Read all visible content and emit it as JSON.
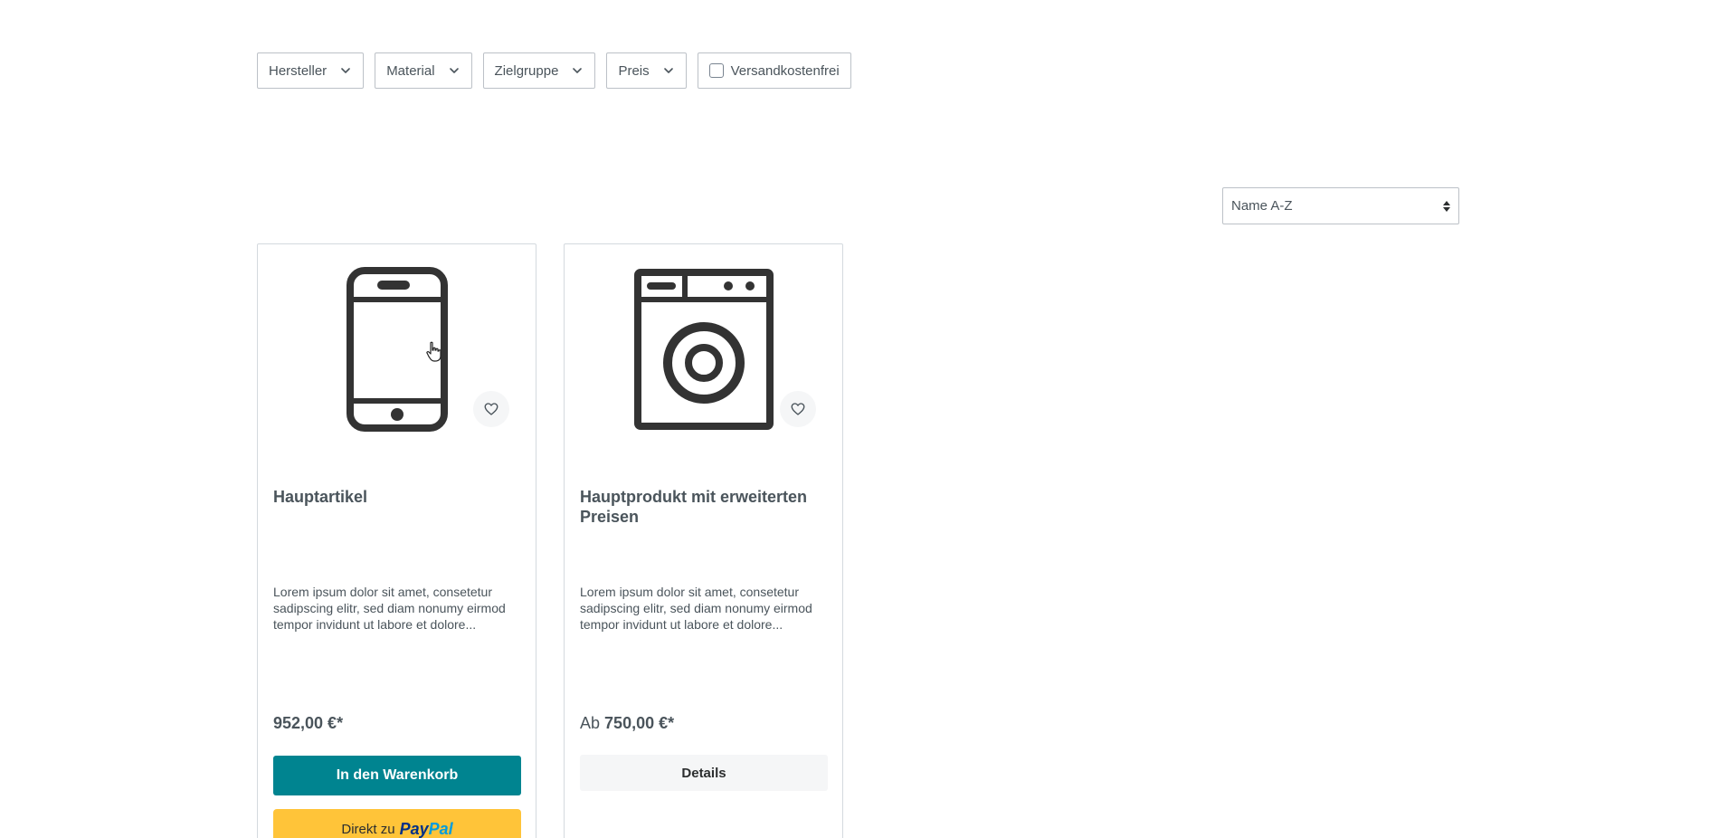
{
  "filters": [
    {
      "label": "Hersteller"
    },
    {
      "label": "Material"
    },
    {
      "label": "Zielgruppe"
    },
    {
      "label": "Preis"
    }
  ],
  "shipping_filter": {
    "label": "Versandkostenfrei",
    "checked": false
  },
  "sort": {
    "selected": "Name A-Z"
  },
  "products": [
    {
      "icon": "smartphone-icon",
      "title": "Hauptartikel",
      "description": "Lorem ipsum dolor sit amet, consetetur sadipscing elitr, sed diam nonumy eirmod tempor invidunt ut labore et dolore...",
      "price_prefix": "",
      "price": "952,00 €*",
      "cart_label": "In den Warenkorb",
      "paypal_label": "Direkt zu",
      "paypal_logo_pay": "Pay",
      "paypal_logo_pal": "Pal"
    },
    {
      "icon": "washing-machine-icon",
      "title": "Hauptprodukt mit erweiterten Preisen",
      "description": "Lorem ipsum dolor sit amet, consetetur sadipscing elitr, sed diam nonumy eirmod tempor invidunt ut labore et dolore...",
      "price_prefix": "Ab",
      "price": "750,00 €*",
      "details_label": "Details"
    }
  ],
  "colors": {
    "accent": "#008490",
    "paypal_yellow": "#ffc439",
    "text": "#4a545b",
    "border": "#bcc1c7"
  }
}
